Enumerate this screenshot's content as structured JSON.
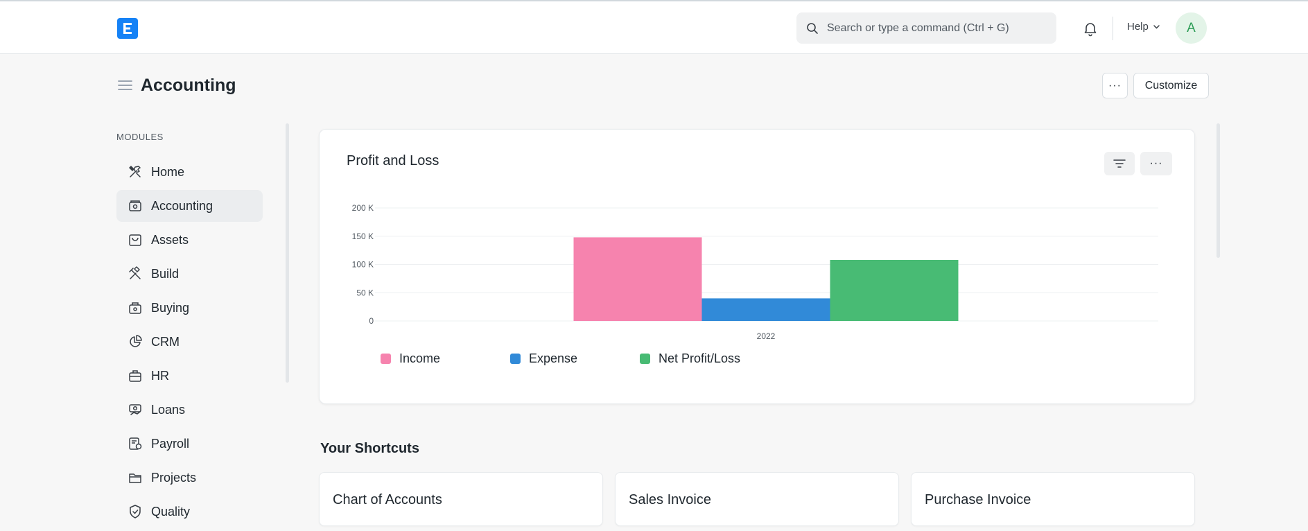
{
  "navbar": {
    "search_placeholder": "Search or type a command (Ctrl + G)",
    "help_label": "Help",
    "avatar_initial": "A"
  },
  "page": {
    "title": "Accounting",
    "more_label": "···",
    "customize_label": "Customize"
  },
  "sidebar": {
    "section_label": "MODULES",
    "items": [
      {
        "label": "Home",
        "icon": "tools-icon"
      },
      {
        "label": "Accounting",
        "icon": "accounting-icon",
        "active": true
      },
      {
        "label": "Assets",
        "icon": "assets-icon"
      },
      {
        "label": "Build",
        "icon": "build-icon"
      },
      {
        "label": "Buying",
        "icon": "buying-icon"
      },
      {
        "label": "CRM",
        "icon": "crm-icon"
      },
      {
        "label": "HR",
        "icon": "hr-icon"
      },
      {
        "label": "Loans",
        "icon": "loans-icon"
      },
      {
        "label": "Payroll",
        "icon": "payroll-icon"
      },
      {
        "label": "Projects",
        "icon": "projects-icon"
      },
      {
        "label": "Quality",
        "icon": "quality-icon"
      }
    ]
  },
  "chart_card": {
    "title": "Profit and Loss",
    "more_label": "···"
  },
  "chart_data": {
    "type": "bar",
    "title": "Profit and Loss",
    "categories": [
      "2022"
    ],
    "series": [
      {
        "name": "Income",
        "values": [
          148000
        ],
        "color": "#f683ae"
      },
      {
        "name": "Expense",
        "values": [
          40000
        ],
        "color": "#318ad8"
      },
      {
        "name": "Net Profit/Loss",
        "values": [
          108000
        ],
        "color": "#48bb74"
      }
    ],
    "y_ticks": [
      "0",
      "50 K",
      "100 K",
      "150 K",
      "200 K"
    ],
    "ylim": [
      0,
      200000
    ],
    "grid": true,
    "legend": "bottom-left"
  },
  "shortcuts": {
    "title": "Your Shortcuts",
    "items": [
      "Chart of Accounts",
      "Sales Invoice",
      "Purchase Invoice"
    ]
  }
}
